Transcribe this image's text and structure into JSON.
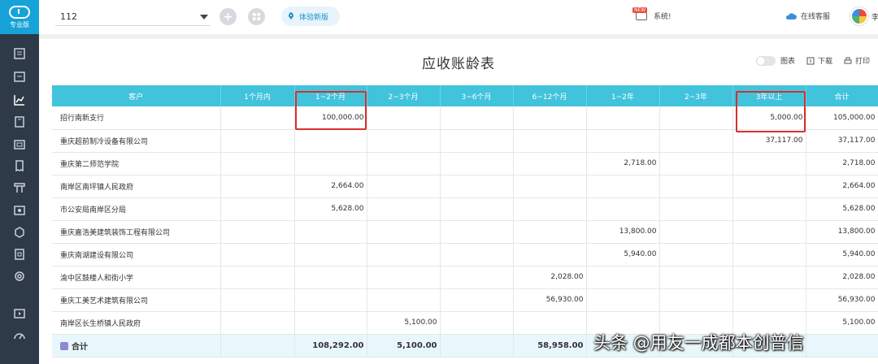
{
  "sidebar": {
    "logo_label": "专业版",
    "icons": [
      "document-icon",
      "voucher-icon",
      "report-chart-icon",
      "ledger-icon",
      "cashier-icon",
      "invoice-icon",
      "asset-icon",
      "payroll-icon",
      "inventory-icon",
      "tax-icon",
      "settings-icon",
      "export-icon",
      "speed-icon"
    ]
  },
  "topbar": {
    "ledger_value": "112",
    "new_version_label": "体验新版",
    "notice_badge": "NEW",
    "notice_label": "系统!",
    "service_label": "在线客服",
    "user_name": "李"
  },
  "report": {
    "title": "应收账龄表",
    "toggle_label": "图表",
    "download_label": "下载",
    "print_label": "打印"
  },
  "table": {
    "headers": [
      "客户",
      "1个月内",
      "1~2个月",
      "2~3个月",
      "3~6个月",
      "6~12个月",
      "1~2年",
      "2~3年",
      "3年以上",
      "合计"
    ],
    "rows": [
      [
        "招行南新支行",
        "",
        "100,000.00",
        "",
        "",
        "",
        "",
        "",
        "5,000.00",
        "105,000.00"
      ],
      [
        "重庆超前制冷设备有限公司",
        "",
        "",
        "",
        "",
        "",
        "",
        "",
        "37,117.00",
        "37,117.00"
      ],
      [
        "重庆第二师范学院",
        "",
        "",
        "",
        "",
        "",
        "2,718.00",
        "",
        "",
        "2,718.00"
      ],
      [
        "南岸区南坪镇人民政府",
        "",
        "2,664.00",
        "",
        "",
        "",
        "",
        "",
        "",
        "2,664.00"
      ],
      [
        "市公安局南岸区分局",
        "",
        "5,628.00",
        "",
        "",
        "",
        "",
        "",
        "",
        "5,628.00"
      ],
      [
        "重庆嘉浩美建筑装饰工程有限公司",
        "",
        "",
        "",
        "",
        "",
        "13,800.00",
        "",
        "",
        "13,800.00"
      ],
      [
        "重庆南湖建设有限公司",
        "",
        "",
        "",
        "",
        "",
        "5,940.00",
        "",
        "",
        "5,940.00"
      ],
      [
        "渝中区鼓楼人和街小学",
        "",
        "",
        "",
        "",
        "2,028.00",
        "",
        "",
        "",
        "2,028.00"
      ],
      [
        "重庆工美艺术建筑有限公司",
        "",
        "",
        "",
        "",
        "56,930.00",
        "",
        "",
        "",
        "56,930.00"
      ],
      [
        "南岸区长生桥镇人民政府",
        "",
        "",
        "5,100.00",
        "",
        "",
        "",
        "",
        "",
        "5,100.00"
      ]
    ],
    "total": [
      "合计",
      "",
      "108,292.00",
      "5,100.00",
      "",
      "58,958.00",
      "",
      "",
      "",
      ""
    ]
  },
  "watermark": "头条 @用友一成都本创普信"
}
